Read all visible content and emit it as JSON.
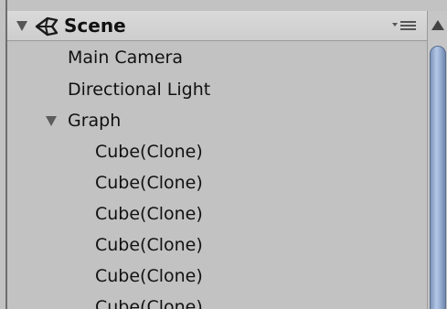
{
  "scene": {
    "name": "Scene",
    "icon": "unity-scene-icon",
    "menu_icon": "sort-menu-icon"
  },
  "items": [
    {
      "label": "Main Camera"
    },
    {
      "label": "Directional Light"
    },
    {
      "label": "Graph",
      "expanded": true
    },
    {
      "label": "Cube(Clone)"
    },
    {
      "label": "Cube(Clone)"
    },
    {
      "label": "Cube(Clone)"
    },
    {
      "label": "Cube(Clone)"
    },
    {
      "label": "Cube(Clone)"
    },
    {
      "label": "Cube(Clone)"
    }
  ],
  "colors": {
    "panel_bg": "#c2c2c2",
    "scroll_thumb": "#9fb6d8"
  }
}
